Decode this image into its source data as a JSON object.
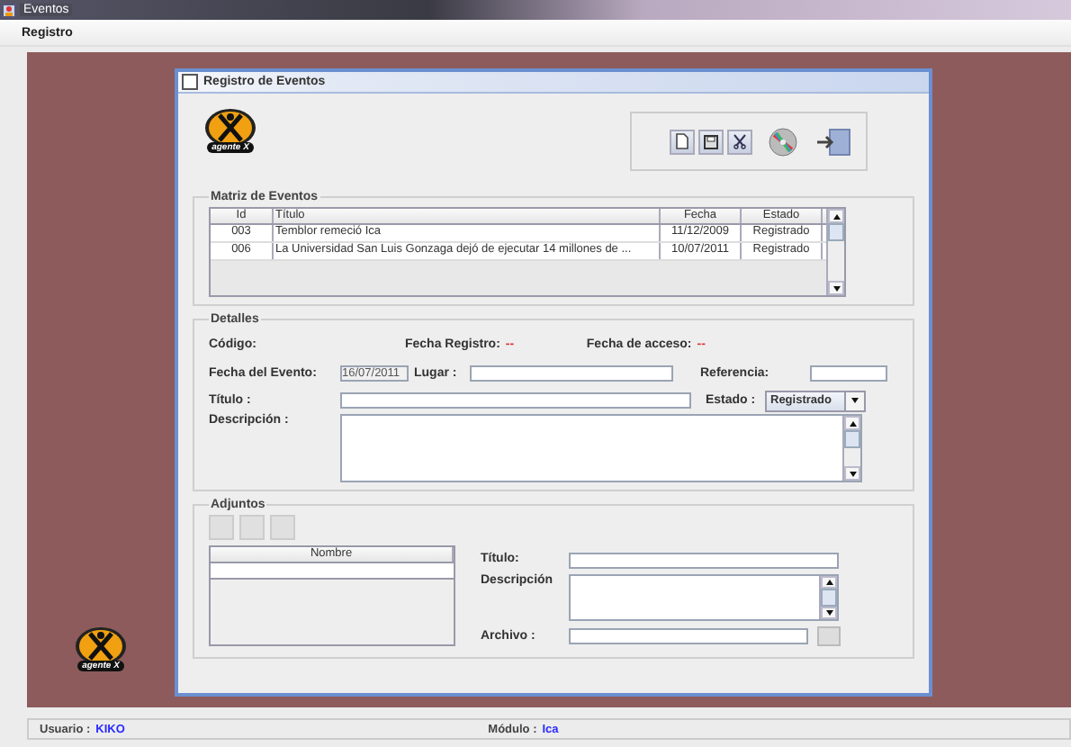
{
  "window": {
    "title": "Eventos"
  },
  "menu": [
    {
      "label": "Registro"
    }
  ],
  "desktop_logo": {
    "text": "agente X"
  },
  "frame": {
    "title": "Registro de Eventos",
    "logo_text": "agente X"
  },
  "matrix": {
    "title": "Matriz de Eventos",
    "columns": [
      "Id",
      "Título",
      "Fecha",
      "Estado"
    ],
    "rows": [
      [
        "003",
        "Temblor remeció Ica",
        "11/12/2009",
        "Registrado"
      ],
      [
        "006",
        "La Universidad San Luis Gonzaga dejó de ejecutar 14 millones de ...",
        "10/07/2011",
        "Registrado"
      ]
    ]
  },
  "details": {
    "title": "Detalles",
    "codigo_label": "Código:",
    "fecha_registro_label": "Fecha Registro:",
    "fecha_registro_value": "--",
    "fecha_acceso_label": "Fecha de acceso:",
    "fecha_acceso_value": "--",
    "fecha_evento_label": "Fecha del Evento:",
    "fecha_evento_value": "16/07/2011",
    "fecha_evento_disabled": true,
    "lugar_label": "Lugar :",
    "referencia_label": "Referencia:",
    "titulo_label": "Título :",
    "estado_label": "Estado :",
    "estado_value": "Registrado",
    "descripcion_label": "Descripción :"
  },
  "attachments": {
    "title": "Adjuntos",
    "columns": [
      "Nombre"
    ],
    "titulo_label": "Título:",
    "descripcion_label": "Descripción",
    "archivo_label": "Archivo :"
  },
  "status_bar": {
    "user_label": "Usuario :",
    "user": "KIKO",
    "module_label": "Módulo :",
    "module": "Ica"
  }
}
